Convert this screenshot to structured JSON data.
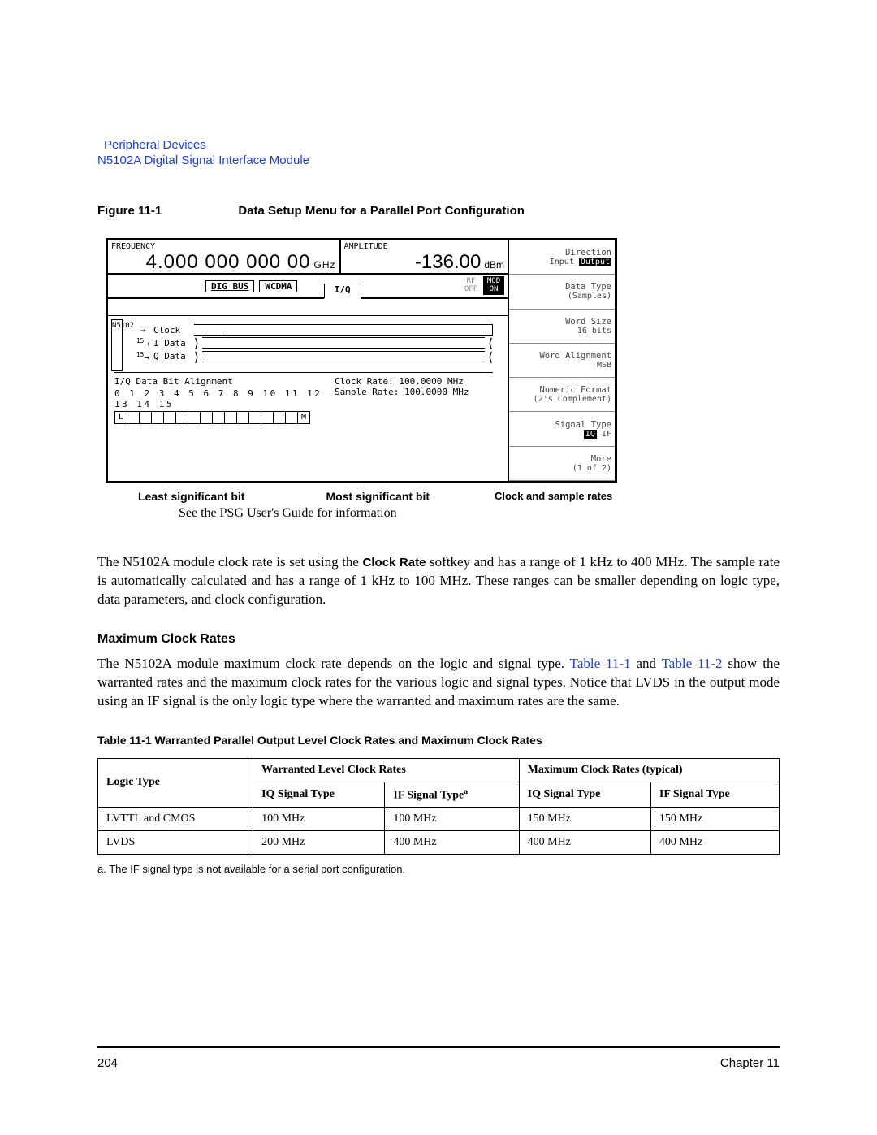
{
  "header": {
    "link": "Peripheral Devices",
    "sub": "N5102A Digital Signal Interface Module"
  },
  "figure": {
    "num": "Figure 11-1",
    "title": "Data Setup Menu for a Parallel Port Configuration"
  },
  "screen": {
    "freq_label": "FREQUENCY",
    "freq_value": "4.000 000 000 00",
    "freq_unit": "GHz",
    "amp_label": "AMPLITUDE",
    "amp_value": "-136.00",
    "amp_unit": "dBm",
    "dig_bus": "DIG BUS",
    "wcdma": "WCDMA",
    "iq_tab": "I/Q",
    "rf_label": "RF",
    "rf_state": "OFF",
    "mod_label": "MOD",
    "mod_state": "ON",
    "vlabel": "N5102",
    "sig_clock": "Clock",
    "sig_i": "I Data",
    "sig_q": "Q Data",
    "bits15a": "15",
    "bits15b": "15",
    "bit_align_title": "I/Q Data Bit Alignment",
    "bit_nums": "0 1 2 3 4 5 6 7 8 9 10 11 12 13 14 15",
    "bit_L": "L",
    "bit_M": "M",
    "clock_rate": "Clock Rate: 100.0000 MHz",
    "sample_rate": "Sample Rate: 100.0000 MHz"
  },
  "softkeys": {
    "direction_label": "Direction",
    "direction_value": "Input Output",
    "data_type_label": "Data Type",
    "data_type_value": "(Samples)",
    "word_size_label": "Word Size",
    "word_size_value": "16 bits",
    "word_align_label": "Word Alignment",
    "word_align_value": "MSB",
    "num_format_label": "Numeric Format",
    "num_format_value": "(2's Complement)",
    "sig_type_label": "Signal Type",
    "sig_type_val": "IQ IF",
    "more_label": "More",
    "more_value": "(1 of 2)"
  },
  "callouts": {
    "lsb": "Least significant bit",
    "msb": "Most significant bit",
    "rates": "Clock and sample rates",
    "see": "See the PSG User's Guide for information"
  },
  "para1a": "The N5102A module clock rate is set using the ",
  "para1_sk": "Clock Rate",
  "para1b": " softkey and has a range of 1 kHz to 400 MHz. The sample rate is automatically calculated and has a range of 1 kHz to 100 MHz. These ranges can be smaller depending on logic type, data parameters, and clock configuration.",
  "section_head": "Maximum Clock Rates",
  "para2a": "The N5102A module maximum clock rate depends on the logic and signal type. ",
  "para2_ref1": "Table 11-1",
  "para2b": " and ",
  "para2_ref2": "Table 11-2",
  "para2c": " show the warranted rates and the maximum clock rates for the various logic and signal types. Notice that LVDS in the output mode using an IF signal is the only logic type where the warranted and maximum rates are the same.",
  "table_caption": "Table 11-1  Warranted Parallel Output Level Clock Rates and Maximum Clock Rates",
  "table": {
    "h_logic": "Logic Type",
    "h_warranted": "Warranted Level Clock Rates",
    "h_max": "Maximum Clock Rates (typical)",
    "h_iq": "IQ Signal Type",
    "h_if_a": "IF Signal Type",
    "h_if": "IF Signal Type",
    "rows": [
      {
        "logic": "LVTTL and CMOS",
        "w_iq": "100 MHz",
        "w_if": "100 MHz",
        "m_iq": "150 MHz",
        "m_if": "150 MHz"
      },
      {
        "logic": "LVDS",
        "w_iq": "200 MHz",
        "w_if": "400 MHz",
        "m_iq": "400 MHz",
        "m_if": "400 MHz"
      }
    ]
  },
  "footnote": "a. The IF signal type is not available for a serial port configuration.",
  "footer": {
    "page": "204",
    "chapter": "Chapter 11"
  }
}
